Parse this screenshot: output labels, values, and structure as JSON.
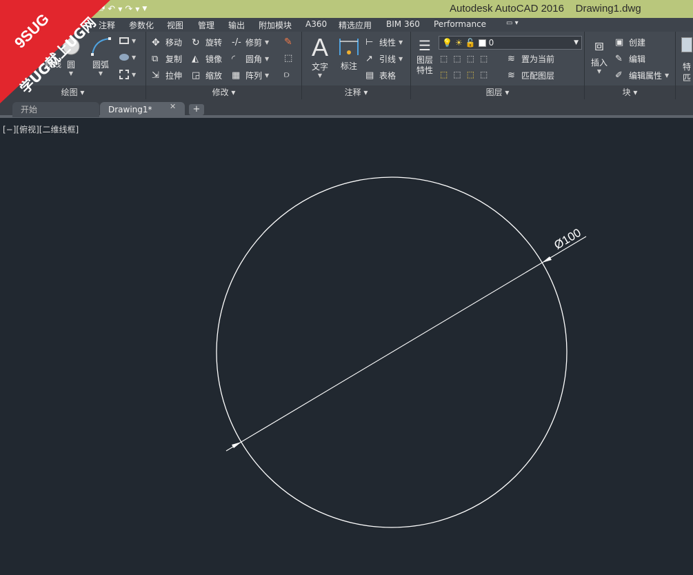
{
  "titlebar": {
    "app_title": "Autodesk AutoCAD 2016",
    "file_name": "Drawing1.dwg"
  },
  "ribbon_tabs": [
    "注释",
    "参数化",
    "视图",
    "管理",
    "输出",
    "附加模块",
    "A360",
    "精选应用",
    "BIM 360",
    "Performance"
  ],
  "draw_panel": {
    "title": "绘图",
    "polyline_label": "多段线",
    "circle_label": "圆",
    "arc_label": "圆弧"
  },
  "modify_panel": {
    "title": "修改",
    "move": "移动",
    "rotate": "旋转",
    "trim": "修剪",
    "copy": "复制",
    "mirror": "镜像",
    "fillet": "圆角",
    "stretch": "拉伸",
    "scale": "缩放",
    "array": "阵列"
  },
  "annotation_panel": {
    "title": "注释",
    "text": "文字",
    "dimension": "标注",
    "linear": "线性",
    "leader": "引线",
    "table": "表格"
  },
  "layers_panel": {
    "title": "图层",
    "layer_properties": "图层\n特性",
    "current_layer": "0",
    "set_current": "置为当前",
    "match_layer": "匹配图层"
  },
  "block_panel": {
    "title": "块",
    "insert": "插入",
    "create": "创建",
    "edit": "编辑",
    "edit_attributes": "编辑属性"
  },
  "properties_panel": {
    "label_top": "特",
    "label_bottom": "匹"
  },
  "doc_tabs": {
    "start": "开始",
    "drawing": "Drawing1*"
  },
  "viewport": {
    "label": "[−][俯视][二维线框]"
  },
  "dimension": {
    "text": "Ø100"
  },
  "watermark": {
    "line1": "9SUG",
    "line2": "学UG就上UG网"
  },
  "colors": {
    "titlebar": "#b9c77c",
    "canvas": "#212830",
    "ribbon": "#444a52",
    "geometry": "#ffffff",
    "watermark": "#e2262d"
  }
}
